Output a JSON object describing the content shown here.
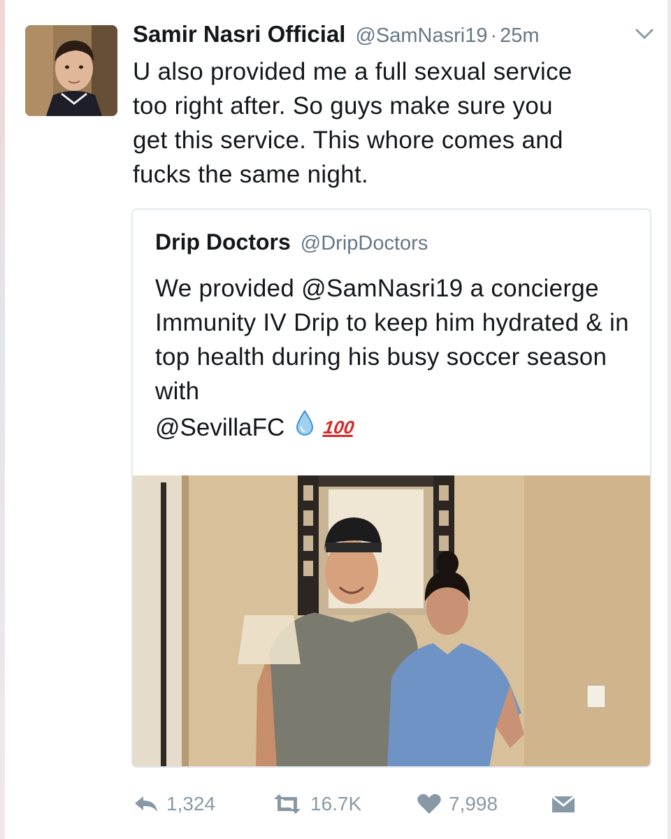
{
  "tweet": {
    "display_name": "Samir Nasri Official",
    "handle": "@SamNasri19",
    "separator": "·",
    "time": "25m",
    "text": "U also provided me a full sexual service\ntoo right after. So guys make sure you\nget this service. This whore comes and\nfucks the same night."
  },
  "quoted_tweet": {
    "display_name": "Drip Doctors",
    "handle": "@DripDoctors",
    "text": "We provided @SamNasri19 a concierge Immunity IV Drip to keep him hydrated & in top health during his busy soccer season with",
    "last_line": "@SevillaFC",
    "emojis": [
      "droplet-emoji",
      "hundred-points-emoji"
    ],
    "hundred_label": "100"
  },
  "actions": {
    "reply_count": "1,324",
    "retweet_count": "16.7K",
    "like_count": "7,998"
  },
  "icons": {
    "caret": "chevron-down-icon",
    "reply": "reply-icon",
    "retweet": "retweet-icon",
    "like": "heart-icon",
    "dm": "envelope-icon"
  },
  "colors": {
    "text": "#14171a",
    "secondary": "#657786",
    "action": "#8899a6",
    "border": "#e1e8ed",
    "droplet": "#4aa3df",
    "hundred": "#d62828"
  }
}
